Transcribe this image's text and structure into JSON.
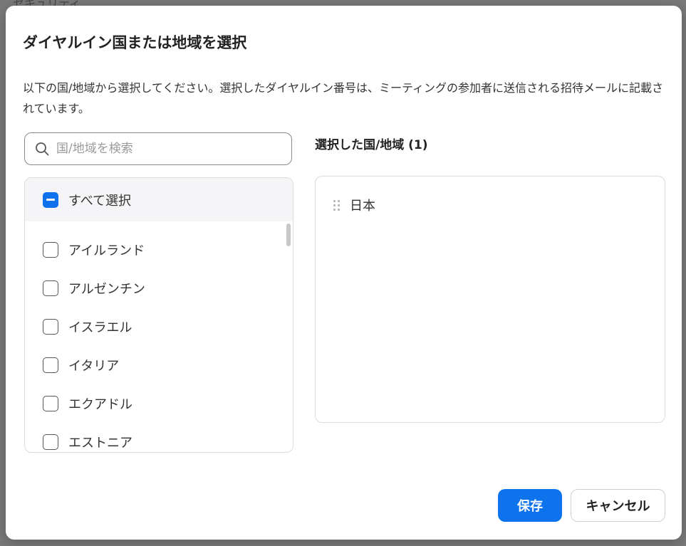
{
  "background": {
    "partial_text": "セキュリティ"
  },
  "dialog": {
    "title": "ダイヤルイン国または地域を選択",
    "description": "以下の国/地域から選択してください。選択したダイヤルイン番号は、ミーティングの参加者に送信される招待メールに記載されています。",
    "search": {
      "placeholder": "国/地域を検索",
      "icon": "search-icon"
    },
    "select_all": {
      "label": "すべて選択",
      "state": "indeterminate"
    },
    "countries": [
      "アイルランド",
      "アルゼンチン",
      "イスラエル",
      "イタリア",
      "エクアドル",
      "エストニア"
    ],
    "selected": {
      "header": "選択した国/地域 (1)",
      "items": [
        "日本"
      ]
    },
    "buttons": {
      "save": "保存",
      "cancel": "キャンセル"
    },
    "colors": {
      "accent": "#0e72ed"
    }
  }
}
